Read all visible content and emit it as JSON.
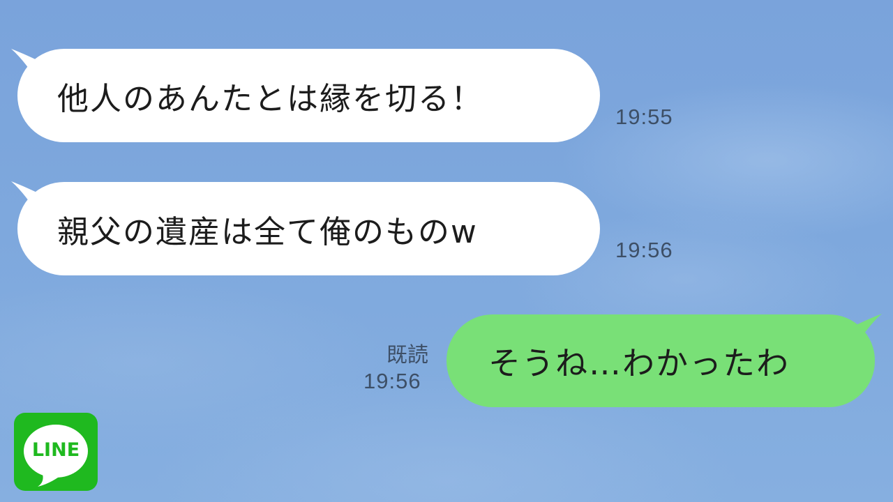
{
  "app": {
    "name": "LINE",
    "logo_text": "LINE",
    "colors": {
      "background": "#7ea6db",
      "incoming_bubble": "#ffffff",
      "outgoing_bubble": "#79e077",
      "logo": "#1fb91f"
    }
  },
  "messages": [
    {
      "direction": "incoming",
      "text": "他人のあんたとは縁を切る！",
      "time": "19:55"
    },
    {
      "direction": "incoming",
      "text": "親父の遺産は全て俺のものw",
      "time": "19:56"
    },
    {
      "direction": "outgoing",
      "text": "そうね…わかったわ",
      "read_label": "既読",
      "time": "19:56"
    }
  ]
}
